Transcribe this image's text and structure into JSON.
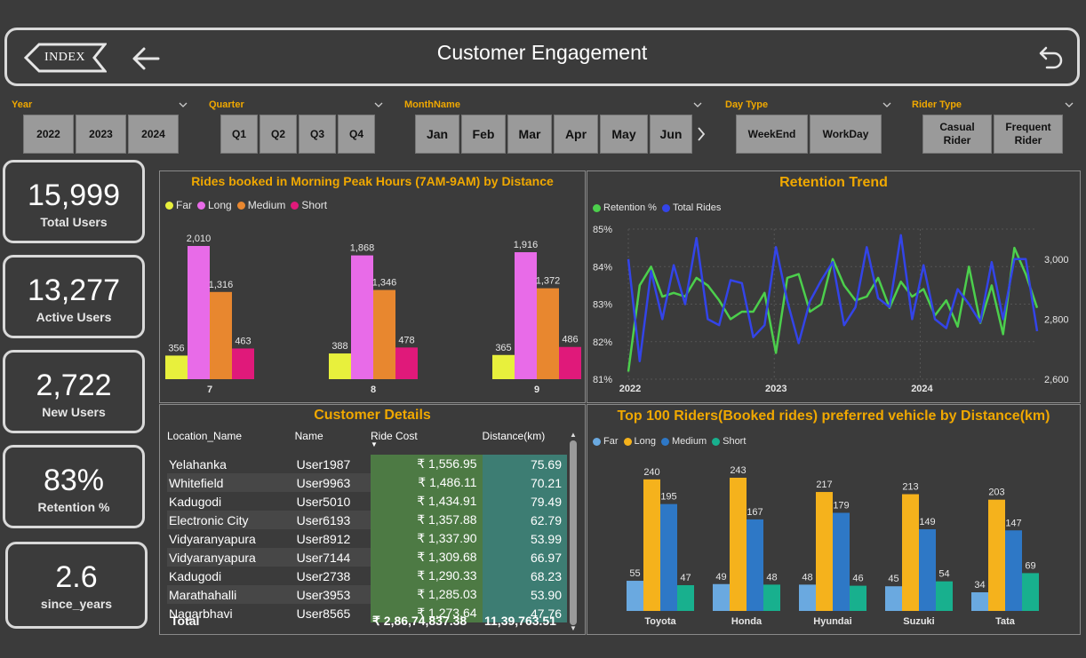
{
  "header": {
    "index_label": "INDEX",
    "title": "Customer Engagement"
  },
  "slicers": {
    "year": {
      "label": "Year",
      "options": [
        "2022",
        "2023",
        "2024"
      ]
    },
    "quarter": {
      "label": "Quarter",
      "options": [
        "Q1",
        "Q2",
        "Q3",
        "Q4"
      ]
    },
    "month": {
      "label": "MonthName",
      "options": [
        "Jan",
        "Feb",
        "Mar",
        "Apr",
        "May",
        "Jun"
      ]
    },
    "daytype": {
      "label": "Day Type",
      "options": [
        "WeekEnd",
        "WorkDay"
      ]
    },
    "ridertype": {
      "label": "Rider Type",
      "options": [
        "Casual Rider",
        "Frequent Rider"
      ]
    }
  },
  "kpis": [
    {
      "value": "15,999",
      "label": "Total Users"
    },
    {
      "value": "13,277",
      "label": "Active Users"
    },
    {
      "value": "2,722",
      "label": "New Users"
    },
    {
      "value": "83%",
      "label": "Retention %"
    },
    {
      "value": "2.6",
      "label": "since_years"
    }
  ],
  "morning_chart": {
    "title": "Rides booked in Morning Peak Hours (7AM-9AM) by Distance"
  },
  "retention_chart": {
    "title": "Retention Trend"
  },
  "vehicle_chart": {
    "title": "Top 100 Riders(Booked rides) preferred vehicle by Distance(km)"
  },
  "customer_details": {
    "title": "Customer Details",
    "columns": [
      "Location_Name",
      "Name",
      "Ride Cost",
      "Distance(km)"
    ],
    "rows": [
      [
        "Yelahanka",
        "User1987",
        "₹ 1,556.95",
        "75.69"
      ],
      [
        "Whitefield",
        "User9963",
        "₹ 1,486.11",
        "70.21"
      ],
      [
        "Kadugodi",
        "User5010",
        "₹ 1,434.91",
        "79.49"
      ],
      [
        "Electronic City",
        "User6193",
        "₹ 1,357.88",
        "62.79"
      ],
      [
        "Vidyaranyapura",
        "User8912",
        "₹ 1,337.90",
        "53.99"
      ],
      [
        "Vidyaranyapura",
        "User7144",
        "₹ 1,309.68",
        "66.97"
      ],
      [
        "Kadugodi",
        "User2738",
        "₹ 1,290.33",
        "68.23"
      ],
      [
        "Marathahalli",
        "User3953",
        "₹ 1,285.03",
        "53.90"
      ],
      [
        "Nagarbhavi",
        "User8565",
        "₹ 1,273.64",
        "47.76"
      ]
    ],
    "total_label": "Total",
    "total_cost": "₹ 2,86,74,837.38",
    "total_distance": "11,39,763.51"
  },
  "chart_data": [
    {
      "type": "bar",
      "title": "Rides booked in Morning Peak Hours (7AM-9AM) by Distance",
      "categories": [
        "7",
        "8",
        "9"
      ],
      "series": [
        {
          "name": "Far",
          "color": "#e8f03c",
          "values": [
            356,
            388,
            365
          ]
        },
        {
          "name": "Long",
          "color": "#e86be8",
          "values": [
            2010,
            1868,
            1916
          ]
        },
        {
          "name": "Medium",
          "color": "#e8872f",
          "values": [
            1316,
            1346,
            1372
          ]
        },
        {
          "name": "Short",
          "color": "#e0197a",
          "values": [
            463,
            478,
            486
          ]
        }
      ],
      "legend": "top-left"
    },
    {
      "type": "line",
      "title": "Retention Trend",
      "x_ticks": [
        "2022",
        "2023",
        "2024"
      ],
      "y_left_ticks": [
        "81%",
        "82%",
        "83%",
        "84%",
        "85%"
      ],
      "y_right_ticks": [
        "2,600",
        "2,800",
        "3,000"
      ],
      "y_left_range": [
        81,
        85
      ],
      "y_right_range": [
        2600,
        3100
      ],
      "grid": true,
      "legend": "top-left",
      "series": [
        {
          "name": "Retention %",
          "color": "#4ccf4c",
          "axis": "left",
          "values": [
            81.2,
            83.5,
            84.0,
            83.2,
            83.3,
            83.2,
            83.7,
            83.5,
            83.1,
            82.6,
            82.8,
            82.8,
            83.3,
            81.7,
            83.7,
            83.8,
            82.8,
            83.0,
            84.2,
            83.5,
            83.1,
            83.2,
            83.7,
            82.9,
            83.6,
            83.2,
            83.4,
            82.7,
            83.1,
            82.4,
            84.0,
            82.5,
            83.5,
            82.2,
            84.5,
            83.8,
            82.9
          ]
        },
        {
          "name": "Total Rides",
          "color": "#3344e8",
          "axis": "right",
          "values": [
            3000,
            2660,
            2960,
            2800,
            2980,
            2850,
            3070,
            2800,
            2780,
            2930,
            2920,
            2740,
            2780,
            3040,
            2860,
            2720,
            2860,
            2930,
            2990,
            2780,
            2840,
            3040,
            2870,
            2840,
            3080,
            2800,
            2980,
            2800,
            2770,
            2900,
            2850,
            2790,
            2990,
            2800,
            3000,
            3000,
            2760
          ]
        }
      ]
    },
    {
      "type": "bar",
      "title": "Top 100 Riders(Booked rides) preferred vehicle by Distance(km)",
      "categories": [
        "Toyota",
        "Honda",
        "Hyundai",
        "Suzuki",
        "Tata"
      ],
      "series": [
        {
          "name": "Far",
          "color": "#6aa9e0",
          "values": [
            55,
            49,
            48,
            45,
            34
          ]
        },
        {
          "name": "Long",
          "color": "#f5b21c",
          "values": [
            240,
            243,
            217,
            213,
            203
          ]
        },
        {
          "name": "Medium",
          "color": "#2e78c6",
          "values": [
            195,
            167,
            179,
            149,
            147
          ]
        },
        {
          "name": "Short",
          "color": "#18b08e",
          "values": [
            47,
            48,
            46,
            54,
            69
          ]
        }
      ],
      "legend": "top-left"
    }
  ]
}
